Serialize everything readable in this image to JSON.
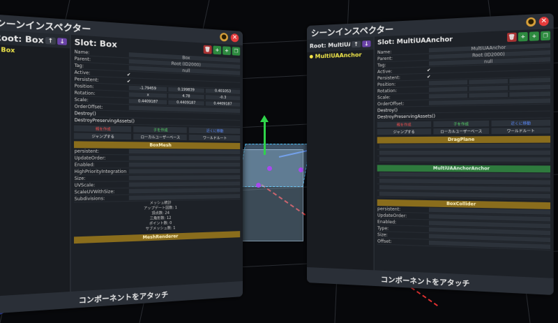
{
  "left_inspector": {
    "title": "シーンインスペクター",
    "root_label": "Root: Box",
    "tree_root": "Box",
    "slot_label": "Slot: Box",
    "fields": [
      {
        "name": "Name:",
        "value": "Box"
      },
      {
        "name": "Parent:",
        "value": "Root (ID2000)"
      },
      {
        "name": "Tag:",
        "value": "null"
      },
      {
        "name": "Active:",
        "value": ""
      },
      {
        "name": "Persistent:",
        "value": ""
      },
      {
        "name": "Position:",
        "value": ""
      },
      {
        "name": "Rotation:",
        "value": ""
      },
      {
        "name": "Scale:",
        "value": ""
      },
      {
        "name": "OrderOffset:",
        "value": ""
      }
    ],
    "position": [
      "-1.79459",
      "0.199839",
      "0.401053"
    ],
    "rotation": [
      "x",
      "4.78",
      "-0.3"
    ],
    "scale": [
      "0.4409187",
      "0.4409187",
      "0.4409187"
    ],
    "actions": [
      "Destroy()",
      "DestroyPreservingAssets()"
    ],
    "buttons_1": [
      "親を作成",
      "子を作成",
      "近くに移動"
    ],
    "buttons_2": [
      "ジャンプする",
      "ローカルユーザーベース",
      "ワールドルート"
    ],
    "component_1": "BoxMesh",
    "mesh_rows": [
      "persistent:",
      "UpdateOrder:",
      "Enabled:",
      "HighPriorityIntegration:",
      "Size:",
      "UVScale:",
      "ScaleUVWithSize:",
      "Subdivisions:"
    ],
    "stats": [
      "メッシュ統計",
      "アップデート回数: 1",
      "頂点数: 24",
      "三角形数: 12",
      "ポイント数: 0",
      "サブメッシュ数: 1"
    ],
    "component_2": "MeshRenderer",
    "footer": "コンポーネントをアタッチ"
  },
  "right_inspector": {
    "title": "シーンインスペクター",
    "root_label": "Root: MultiUAAnchor",
    "tree_root": "MultiUAAnchor",
    "slot_label": "Slot: MultiUAAnchor",
    "fields": [
      {
        "name": "Name:",
        "value": "MultiUAAnchor"
      },
      {
        "name": "Parent:",
        "value": "Root (ID2000)"
      },
      {
        "name": "Tag:",
        "value": "null"
      },
      {
        "name": "Active:",
        "value": ""
      },
      {
        "name": "Persistent:",
        "value": ""
      },
      {
        "name": "Position:",
        "value": ""
      },
      {
        "name": "Rotation:",
        "value": ""
      },
      {
        "name": "Scale:",
        "value": ""
      },
      {
        "name": "OrderOffset:",
        "value": ""
      }
    ],
    "actions": [
      "Destroy()",
      "DestroyPreservingAssets()"
    ],
    "buttons_1": [
      "親を作成",
      "子を作成",
      "近くに移動"
    ],
    "buttons_2": [
      "ジャンプする",
      "ローカルユーザーベース",
      "ワールドルート"
    ],
    "component_1": "DragPlane",
    "component_2": "MultiUAAnchorAnchor",
    "component_3": "BoxCollider",
    "collider_rows": [
      "persistent:",
      "UpdateOrder:",
      "Enabled:",
      "Type:",
      "Size:",
      "Offset:"
    ],
    "footer": "コンポーネントをアタッチ"
  }
}
